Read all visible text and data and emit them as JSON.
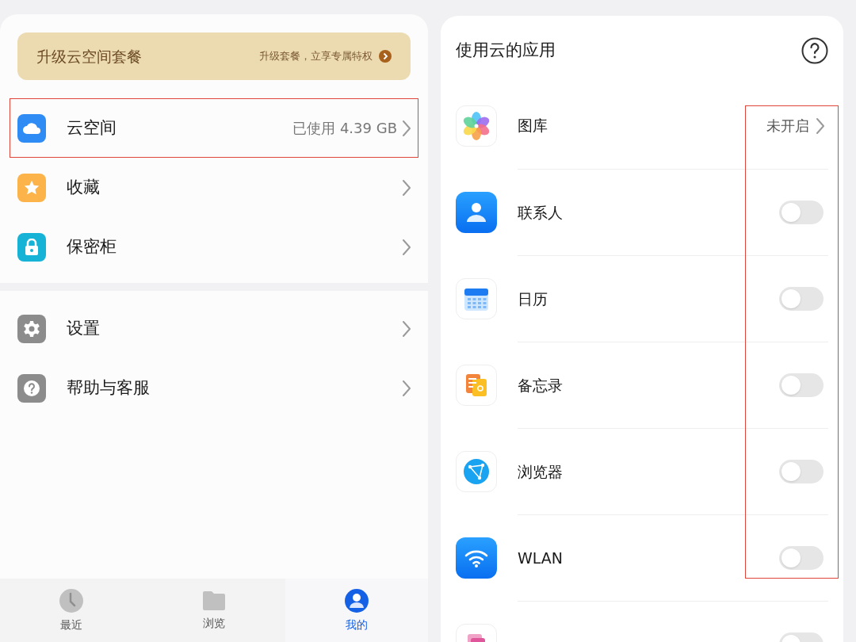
{
  "banner": {
    "title": "升级云空间套餐",
    "action": "升级套餐，立享专属特权"
  },
  "menu_groups": [
    [
      {
        "label": "云空间",
        "value": "已使用 4.39 GB",
        "highlighted": true
      },
      {
        "label": "收藏",
        "highlighted": false
      },
      {
        "label": "保密柜",
        "highlighted": false
      }
    ],
    [
      {
        "label": "设置",
        "highlighted": false
      },
      {
        "label": "帮助与客服",
        "highlighted": false
      }
    ]
  ],
  "bottom_nav": [
    {
      "label": "最近",
      "selected": false
    },
    {
      "label": "浏览",
      "selected": false
    },
    {
      "label": "我的",
      "selected": true
    }
  ],
  "apps_panel": {
    "title": "使用云的应用",
    "status_highlighted": true,
    "apps": [
      {
        "name": "图库",
        "kind": "link",
        "status": "未开启"
      },
      {
        "name": "联系人",
        "kind": "toggle",
        "on": false
      },
      {
        "name": "日历",
        "kind": "toggle",
        "on": false
      },
      {
        "name": "备忘录",
        "kind": "toggle",
        "on": false
      },
      {
        "name": "浏览器",
        "kind": "toggle",
        "on": false
      },
      {
        "name": "WLAN",
        "kind": "toggle",
        "on": false
      },
      {
        "kind": "toggle",
        "on": false
      }
    ]
  }
}
